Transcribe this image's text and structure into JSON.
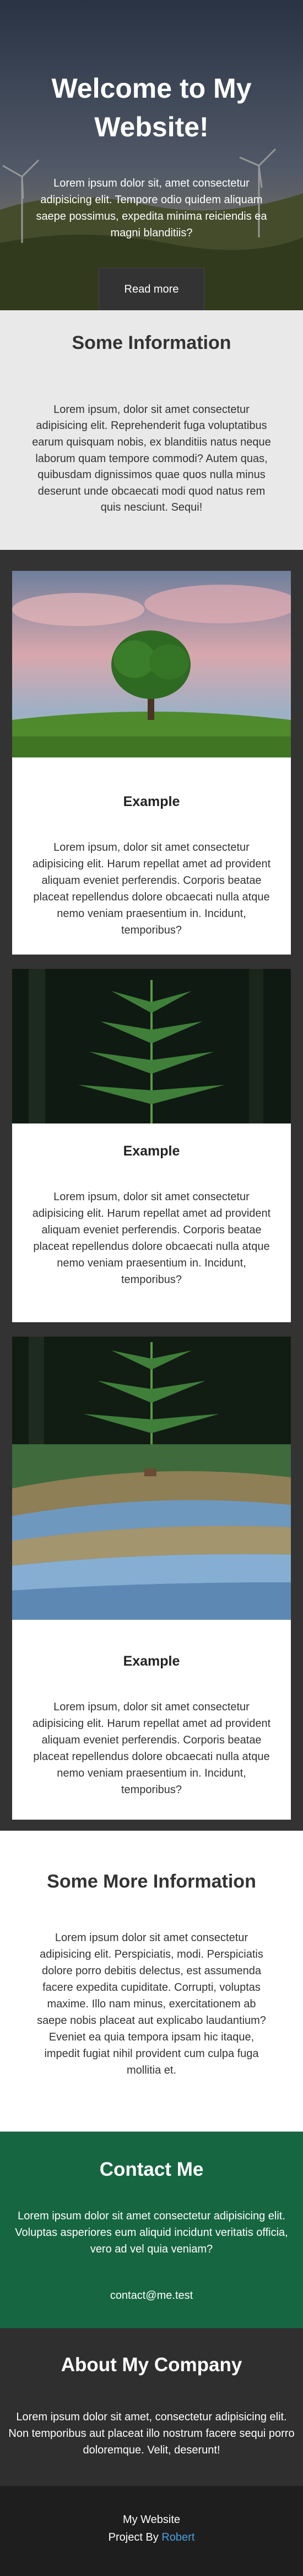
{
  "hero": {
    "title": "Welcome to My Website!",
    "text": "Lorem ipsum dolor sit, amet consectetur adipisicing elit. Tempore odio quidem aliquam saepe possimus, expedita minima reiciendis ea magni blanditiis?",
    "button_label": "Read more"
  },
  "info": {
    "title": "Some Information",
    "text": "Lorem ipsum, dolor sit amet consectetur adipisicing elit. Reprehenderit fuga voluptatibus earum quisquam nobis, ex blanditiis natus neque laborum quam tempore commodi? Autem quas, quibusdam dignissimos quae quos nulla minus deserunt unde obcaecati modi quod natus rem quis nesciunt. Sequi!"
  },
  "cards": [
    {
      "title": "Example",
      "text": "Lorem ipsum, dolor sit amet consectetur adipisicing elit. Harum repellat amet ad provident aliquam eveniet perferendis. Corporis beatae placeat repellendus dolore obcaecati nulla atque nemo veniam praesentium in. Incidunt, temporibus?"
    },
    {
      "title": "Example",
      "text": "Lorem ipsum, dolor sit amet consectetur adipisicing elit. Harum repellat amet ad provident aliquam eveniet perferendis. Corporis beatae placeat repellendus dolore obcaecati nulla atque nemo veniam praesentium in. Incidunt, temporibus?"
    },
    {
      "title": "Example",
      "text": "Lorem ipsum, dolor sit amet consectetur adipisicing elit. Harum repellat amet ad provident aliquam eveniet perferendis. Corporis beatae placeat repellendus dolore obcaecati nulla atque nemo veniam praesentium in. Incidunt, temporibus?"
    }
  ],
  "more": {
    "title": "Some More Information",
    "text": "Lorem ipsum dolor sit amet consectetur adipisicing elit. Perspiciatis, modi. Perspiciatis dolore porro debitis delectus, est assumenda facere expedita cupiditate. Corrupti, voluptas maxime. Illo nam minus, exercitationem ab saepe nobis placeat aut explicabo laudantium? Eveniet ea quia tempora ipsam hic itaque, impedit fugiat nihil provident cum culpa fuga mollitia et."
  },
  "contact": {
    "title": "Contact Me",
    "text": "Lorem ipsum dolor sit amet consectetur adipisicing elit. Voluptas asperiores eum aliquid incidunt veritatis officia, vero ad vel quia veniam?",
    "email": "contact@me.test"
  },
  "about": {
    "title": "About My Company",
    "text": "Lorem ipsum dolor sit amet, consectetur adipisicing elit. Non temporibus aut placeat illo nostrum facere sequi porro doloremque. Velit, deserunt!"
  },
  "footer": {
    "site_name": "My Website",
    "credit_prefix": "Project By",
    "author": "Robert"
  },
  "colors": {
    "contact_bg": "#176642",
    "author_link": "#4a9fe0"
  }
}
